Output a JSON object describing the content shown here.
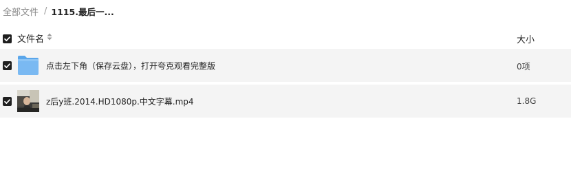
{
  "breadcrumb": {
    "root": "全部文件",
    "separator": "/",
    "current": "1115.最后一..."
  },
  "table": {
    "header": {
      "name_label": "文件名",
      "size_label": "大小",
      "sort_icon": "sort-updown-icon"
    },
    "rows": [
      {
        "icon": "folder-icon",
        "name": "点击左下角（保存云盘），打开夸克观看完整版",
        "size": "0项",
        "checked": true
      },
      {
        "icon": "video-thumbnail",
        "name": "z后y班.2014.HD1080p.中文字幕.mp4",
        "size": "1.8G",
        "checked": true
      }
    ]
  },
  "colors": {
    "row_background": "#f4f4f4",
    "checkbox": "#1f1f1f",
    "folder": "#6cb2f0"
  }
}
